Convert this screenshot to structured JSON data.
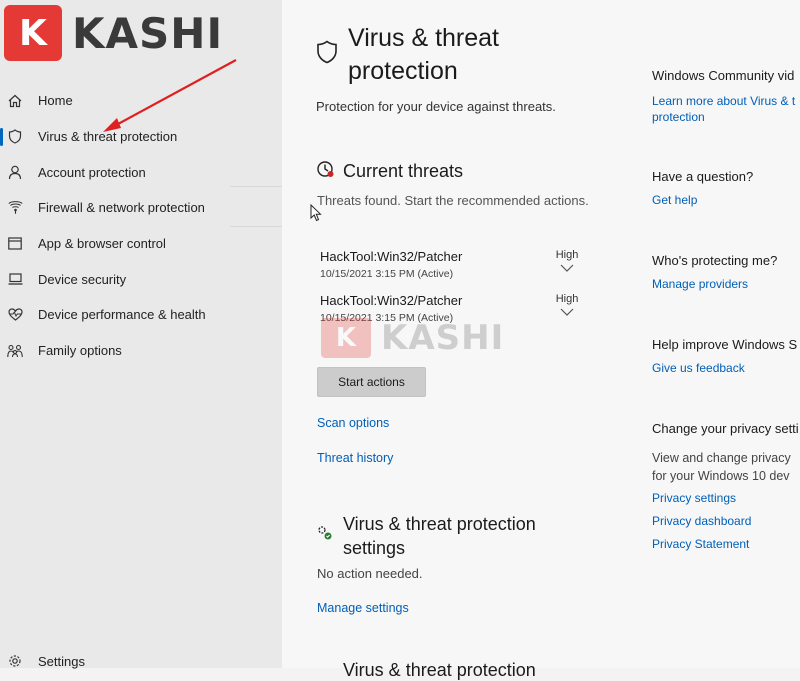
{
  "logo": {
    "letter": "K",
    "text": "KASHI"
  },
  "sidebar": {
    "items": [
      {
        "label": "Home",
        "icon": "home-icon"
      },
      {
        "label": "Virus & threat protection",
        "icon": "shield-icon",
        "active": true
      },
      {
        "label": "Account protection",
        "icon": "person-icon"
      },
      {
        "label": "Firewall & network protection",
        "icon": "wifi-icon"
      },
      {
        "label": "App & browser control",
        "icon": "browser-window-icon"
      },
      {
        "label": "Device security",
        "icon": "laptop-icon"
      },
      {
        "label": "Device performance & health",
        "icon": "heart-icon"
      },
      {
        "label": "Family options",
        "icon": "family-icon"
      }
    ],
    "settings_label": "Settings"
  },
  "main": {
    "title": "Virus & threat protection",
    "title_line1": "Virus & threat",
    "title_line2": "protection",
    "subtitle": "Protection for your device against threats.",
    "current_threats": {
      "heading": "Current threats",
      "description": "Threats found. Start the recommended actions.",
      "threats": [
        {
          "name": "HackTool:Win32/Patcher",
          "date": "10/15/2021 3:15 PM (Active)",
          "severity": "High"
        },
        {
          "name": "HackTool:Win32/Patcher",
          "date": "10/15/2021 3:15 PM (Active)",
          "severity": "High"
        }
      ],
      "start_button": "Start actions",
      "scan_options": "Scan options",
      "threat_history": "Threat history"
    },
    "settings_section": {
      "heading_line1": "Virus & threat protection",
      "heading_line2": "settings",
      "status": "No action needed.",
      "manage_link": "Manage settings"
    },
    "bottom_heading": "Virus & threat protection"
  },
  "right": {
    "community_heading": "Windows Community vid",
    "community_link_line1": "Learn more about Virus & t",
    "community_link_line2": "protection",
    "question_heading": "Have a question?",
    "get_help": "Get help",
    "protecting_heading": "Who's protecting me?",
    "manage_providers": "Manage providers",
    "improve_heading": "Help improve Windows S",
    "feedback": "Give us feedback",
    "privacy_heading": "Change your privacy setti",
    "privacy_text_line1": "View and change privacy",
    "privacy_text_line2": "for your Windows 10 dev",
    "privacy_settings": "Privacy settings",
    "privacy_dashboard": "Privacy dashboard",
    "privacy_statement": "Privacy Statement"
  },
  "watermark": {
    "letter": "K",
    "text": "KASHI"
  },
  "colors": {
    "accent": "#0067c0",
    "link": "#005fb8",
    "brand_red": "#e53935",
    "arrow": "#e02020"
  }
}
